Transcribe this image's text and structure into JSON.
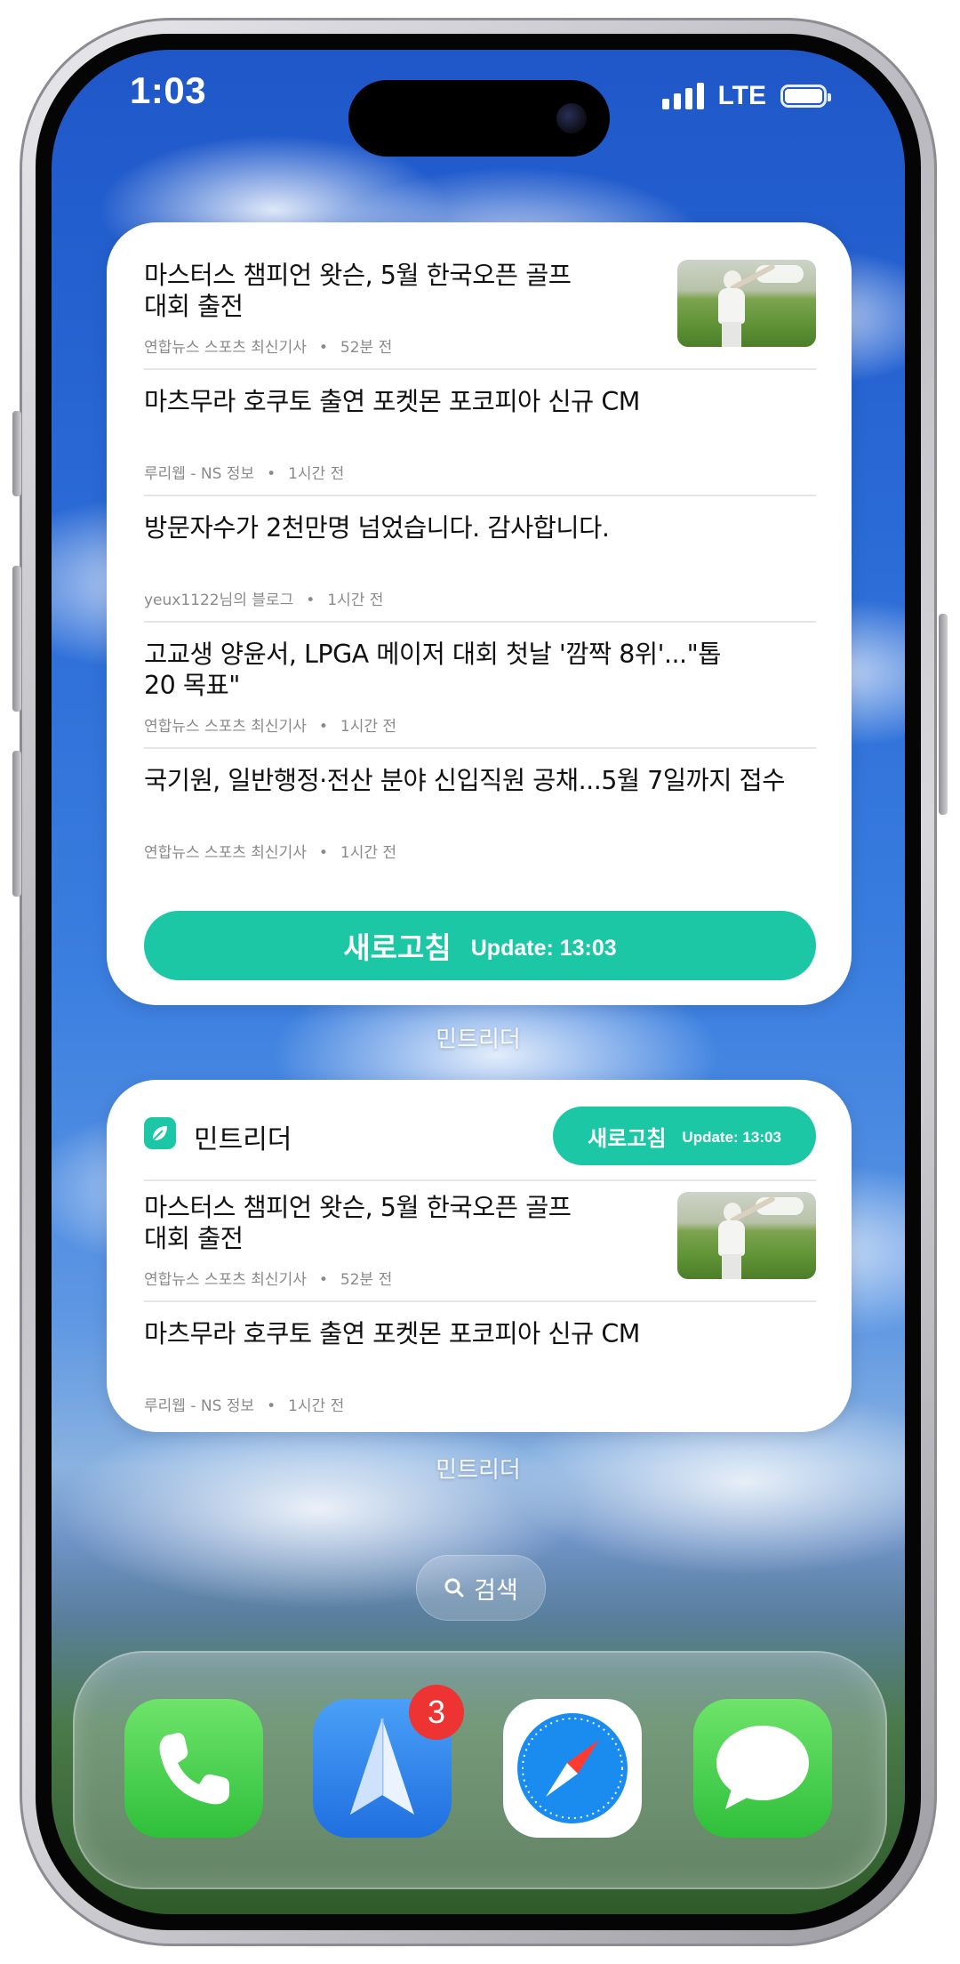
{
  "status_bar": {
    "time": "1:03",
    "network": "LTE"
  },
  "news_widget_large": {
    "items": [
      {
        "title": "마스터스 챔피언 왓슨, 5월 한국오픈 골프 대회 출전",
        "title_line1": "마스터스 챔피언 왓슨, 5월 한국오픈 골프",
        "title_line2": "대회 출전",
        "source": "연합뉴스 스포츠 최신기사",
        "age": "52분 전",
        "has_thumbnail": true
      },
      {
        "title": "마츠무라 호쿠토 출연 포켓몬 포코피아 신규 CM",
        "source": "루리웹 - NS 정보",
        "age": "1시간 전"
      },
      {
        "title": "방문자수가 2천만명 넘었습니다. 감사합니다.",
        "source": "yeux1122님의 블로그",
        "age": "1시간 전"
      },
      {
        "title": "고교생 양윤서, LPGA 메이저 대회 첫날 '깜짝 8위'...\"톱 20 목표\"",
        "title_line1": "고교생 양윤서, LPGA 메이저 대회 첫날 '깜짝 8위'...\"톱",
        "title_line2": "20 목표\"",
        "source": "연합뉴스 스포츠 최신기사",
        "age": "1시간 전"
      },
      {
        "title": "국기원, 일반행정·전산 분야 신입직원 공채...5월 7일까지 접수",
        "source": "연합뉴스 스포츠 최신기사",
        "age": "1시간 전"
      }
    ],
    "refresh_label": "새로고침",
    "update_text": "Update: 13:03",
    "caption": "민트리더"
  },
  "news_widget_medium": {
    "app_name": "민트리더",
    "refresh_label": "새로고침",
    "update_text": "Update: 13:03",
    "items": [
      {
        "title": "마스터스 챔피언 왓슨, 5월 한국오픈 골프 대회 출전",
        "title_line1": "마스터스 챔피언 왓슨, 5월 한국오픈 골프",
        "title_line2": "대회 출전",
        "source": "연합뉴스 스포츠 최신기사",
        "age": "52분 전",
        "has_thumbnail": true
      },
      {
        "title": "마츠무라 호쿠토 출연 포켓몬 포코피아 신규 CM",
        "source": "루리웹 - NS 정보",
        "age": "1시간 전"
      }
    ],
    "caption": "민트리더"
  },
  "search": {
    "label": "검색"
  },
  "dock": {
    "apps": [
      {
        "name": "phone",
        "icon": "phone-icon"
      },
      {
        "name": "spark-mail",
        "icon": "paper-plane-icon",
        "badge": "3"
      },
      {
        "name": "safari",
        "icon": "compass-icon"
      },
      {
        "name": "messages",
        "icon": "speech-bubble-icon"
      }
    ]
  },
  "colors": {
    "accent": "#1cc7a6",
    "badge": "#ee3333"
  }
}
